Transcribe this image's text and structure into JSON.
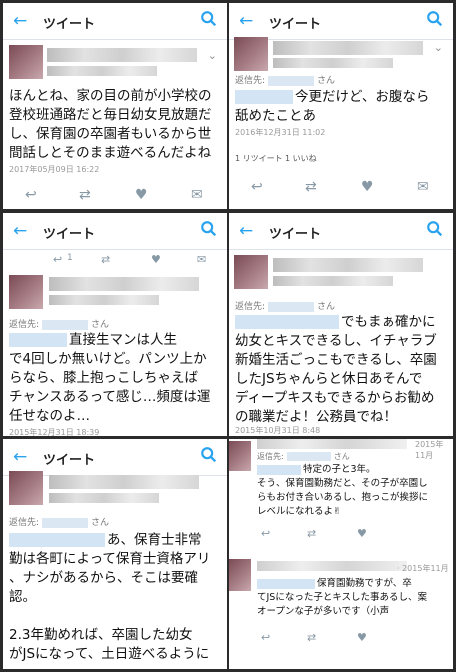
{
  "header": {
    "title": "ツイート"
  },
  "panel1": {
    "text": [
      "ほんとね、家の目の前が小学校の",
      "登校班通路だと毎日幼女見放題だ",
      "し、保育園の卒園者もいるから世",
      "間話しとそのまま遊べるんだよね"
    ],
    "time": "2017年05月09日 16:22"
  },
  "panel2": {
    "reply_prefix": "返信先:",
    "reply_suffix": "さん",
    "text": [
      "今更だけど、お腹なら",
      "舐めたことあ"
    ],
    "time": "2016年12月31日 11:02",
    "retweets": "1 リツイート",
    "likes": "1 いいね"
  },
  "panel3": {
    "reply_prefix": "返信先:",
    "reply_suffix": "さん",
    "text": [
      "直接生マンは人生",
      "で4回しか無いけど。パンツ上か",
      "らなら、膝上抱っこしちゃえば",
      "チャンスあるって感じ…頻度は運",
      "任せなのよ…"
    ],
    "time": "2015年12月31日 18:39",
    "top_count": "1"
  },
  "panel4": {
    "reply_prefix": "返信先:",
    "reply_suffix": "さん",
    "text": [
      "でもまぁ確かに",
      "幼女とキスできるし、イチャラブ",
      "新婚生活ごっこもできるし、卒園",
      "したJSちゃんらと休日あそんで",
      "ディープキスもできるからお勧め",
      "の職業だよ！公務員でね！"
    ],
    "time": "2015年10月31日 8:48"
  },
  "panel5": {
    "reply_prefix": "返信先:",
    "reply_suffix": "さん",
    "text": [
      "あ、保育士非常",
      "勤は各町によって保育士資格アリ",
      "、ナシがあるから、そこは要確",
      "認。",
      "",
      "2.3年勤めれば、卒園した幼女",
      "がJSになって、土日遊べるように"
    ]
  },
  "panel6": {
    "reply_prefix": "返信先:",
    "reply_suffix": "さん",
    "top_time": "2015年11月",
    "text": [
      "特定の子と3年。",
      "そう、保育園勤務だと、その子が卒園し",
      "らもお付き合いあるし、抱っこが挨拶に",
      "レベルになれるよ✌"
    ],
    "time2": "· 2015年11月",
    "text2": [
      "保育園勤務ですが、卒",
      "てJSになった子とキスした事あるし、案",
      "オープンな子が多いです（小声"
    ]
  }
}
